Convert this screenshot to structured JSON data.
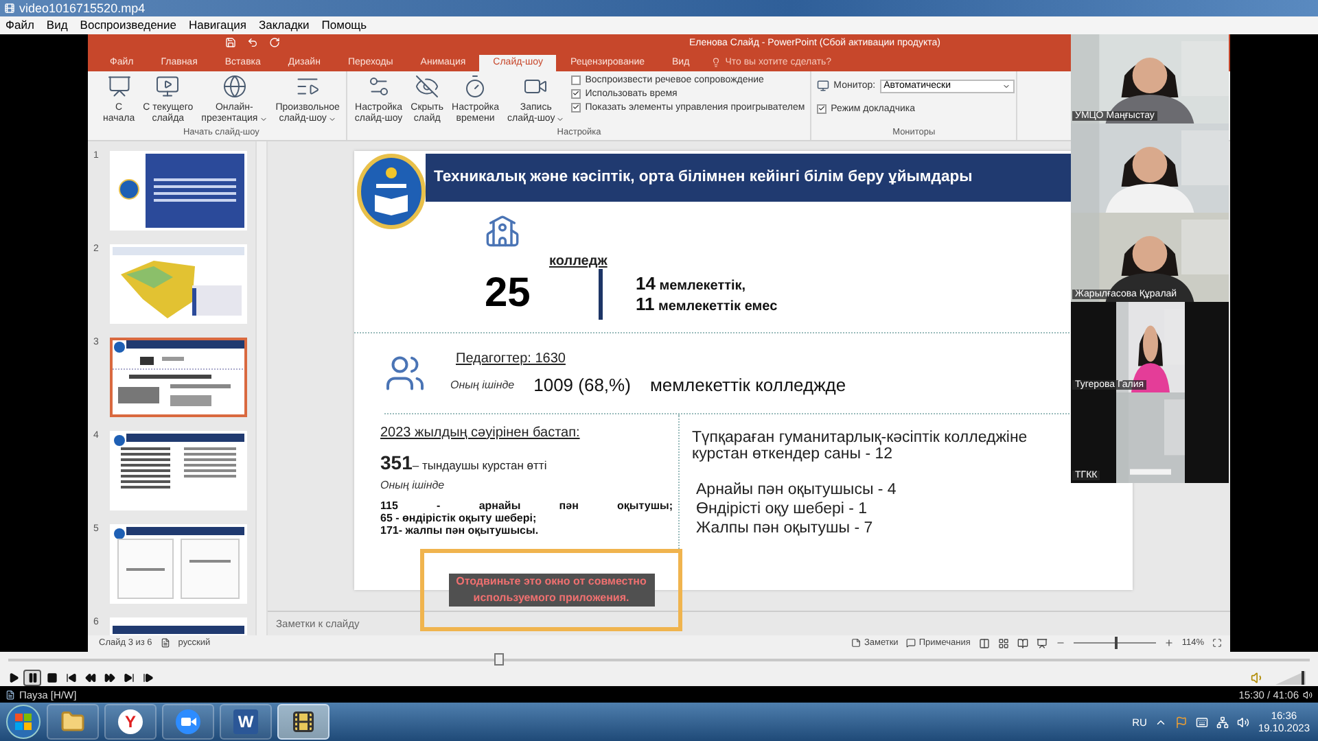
{
  "player_window": {
    "title": "video1016715520.mp4"
  },
  "menu": [
    "Файл",
    "Вид",
    "Воспроизведение",
    "Навигация",
    "Закладки",
    "Помощь"
  ],
  "powerpoint": {
    "title": "Еленова Слайд - PowerPoint (Сбой активации продукта)",
    "tabs": [
      {
        "label": "Файл",
        "selected": false
      },
      {
        "label": "Главная",
        "selected": false
      },
      {
        "label": "Вставка",
        "selected": false
      },
      {
        "label": "Дизайн",
        "selected": false
      },
      {
        "label": "Переходы",
        "selected": false
      },
      {
        "label": "Анимация",
        "selected": false
      },
      {
        "label": "Слайд-шоу",
        "selected": true
      },
      {
        "label": "Рецензирование",
        "selected": false
      },
      {
        "label": "Вид",
        "selected": false
      }
    ],
    "tell_me": "Что вы хотите сделать?",
    "ribbon_groups": [
      {
        "label": "Начать слайд-шоу",
        "buttons": [
          {
            "kind": "start",
            "lines": [
              "С",
              "начала"
            ],
            "dropdown": false
          },
          {
            "kind": "current",
            "lines": [
              "С текущего",
              "слайда"
            ],
            "dropdown": false
          },
          {
            "kind": "online",
            "lines": [
              "Онлайн-",
              "презентация"
            ],
            "dropdown": true
          },
          {
            "kind": "custom",
            "lines": [
              "Произвольное",
              "слайд-шоу"
            ],
            "dropdown": true
          }
        ]
      },
      {
        "label": "Настройка",
        "buttons": [
          {
            "kind": "setup",
            "lines": [
              "Настройка",
              "слайд-шоу"
            ],
            "dropdown": false
          },
          {
            "kind": "hide",
            "lines": [
              "Скрыть",
              "слайд"
            ],
            "dropdown": false
          },
          {
            "kind": "timing",
            "lines": [
              "Настройка",
              "времени"
            ],
            "dropdown": false
          },
          {
            "kind": "record",
            "lines": [
              "Запись",
              "слайд-шоу"
            ],
            "dropdown": true
          }
        ],
        "checkboxes": [
          {
            "label": "Воспроизвести речевое сопровождение",
            "checked": false
          },
          {
            "label": "Использовать время",
            "checked": true
          },
          {
            "label": "Показать элементы управления проигрывателем",
            "checked": true
          }
        ]
      },
      {
        "label": "Мониторы",
        "monitor_label": "Монитор:",
        "monitor_value": "Автоматически",
        "checkboxes": [
          {
            "label": "Режим докладчика",
            "checked": true
          }
        ]
      }
    ],
    "thumbnails": [
      {
        "number": "1",
        "kind": "cover",
        "selected": false
      },
      {
        "number": "2",
        "kind": "map",
        "selected": false
      },
      {
        "number": "3",
        "kind": "stats",
        "selected": true
      },
      {
        "number": "4",
        "kind": "text",
        "selected": false
      },
      {
        "number": "5",
        "kind": "documents",
        "selected": false
      },
      {
        "number": "6",
        "kind": "header",
        "selected": false
      }
    ],
    "slide": {
      "title": "Техникалық және кәсіптік, орта білімнен кейінгі білім беру ұйымдары",
      "college_label": "колледж",
      "college_count": "25",
      "breakdown": [
        {
          "count": "14",
          "text": "мемлекеттік,"
        },
        {
          "count": "11",
          "text": "мемлекеттік емес"
        }
      ],
      "teachers": "Педагогтер: 1630",
      "teachers_note": "Оның ішінде",
      "teachers_count": "1009 (68,%)",
      "teachers_place": "мемлекеттік колледжде",
      "since": "2023 жылдың сәуірінен бастап:",
      "trained_count": "351",
      "trained_text": "– тындаушы курстан өтті",
      "trained_note": "Оның ішінде",
      "trained_list": [
        "115 - арнайы пән оқытушы;",
        "65 - өндірістік оқыту шебері;",
        "171- жалпы пән оқытушысы."
      ],
      "college_lines": [
        "Түпқараған гуманитарлық-кәсіптік колледжіне",
        "курстан өткендер саны - 12"
      ],
      "college_list": [
        "Арнайы пән оқытушысы - 4",
        "Өндірісті оқу шебері - 1",
        "Жалпы пән оқытушы - 7"
      ]
    },
    "notes_placeholder": "Заметки к слайду",
    "status": {
      "slide_info": "Слайд 3 из 6",
      "language": "русский",
      "notes": "Заметки",
      "comments": "Примечания",
      "zoom_slider": {
        "level": 0.5
      },
      "zoom": "114%"
    }
  },
  "share_warning": "Отодвиньте это окно от совместно используемого приложения.",
  "participants": [
    {
      "name": "УМЦО Маңғыстау",
      "kind": "full"
    },
    {
      "kind": "full"
    },
    {
      "name": "Жарылғасова Құралай",
      "kind": "full"
    },
    {
      "name": "Тугерова Галия",
      "kind": "narrow"
    },
    {
      "name": "ТГКК",
      "kind": "narrow"
    }
  ],
  "controls": {
    "seek": {
      "level": 0.377
    },
    "buttons": [
      {
        "kind": "play",
        "selected": false
      },
      {
        "kind": "pause",
        "selected": true
      },
      {
        "kind": "stop",
        "selected": false
      },
      {
        "kind": "previous",
        "selected": false
      },
      {
        "kind": "rewind",
        "selected": false
      },
      {
        "kind": "forward",
        "selected": false
      },
      {
        "kind": "next",
        "selected": false
      },
      {
        "kind": "frame",
        "selected": false
      }
    ],
    "volume": {
      "level": 0.85
    }
  },
  "player_status": {
    "state": "Пауза [H/W]",
    "time": "15:30 / 41:06"
  },
  "taskbar": {
    "apps": [
      {
        "kind": "explorer",
        "active": false
      },
      {
        "kind": "browser",
        "glyph": "Y",
        "active": false
      },
      {
        "kind": "zoom",
        "active": false
      },
      {
        "kind": "word",
        "glyph": "W",
        "active": false
      },
      {
        "kind": "media",
        "active": true
      }
    ],
    "language": "RU",
    "time": "16:36",
    "date": "19.10.2023"
  }
}
